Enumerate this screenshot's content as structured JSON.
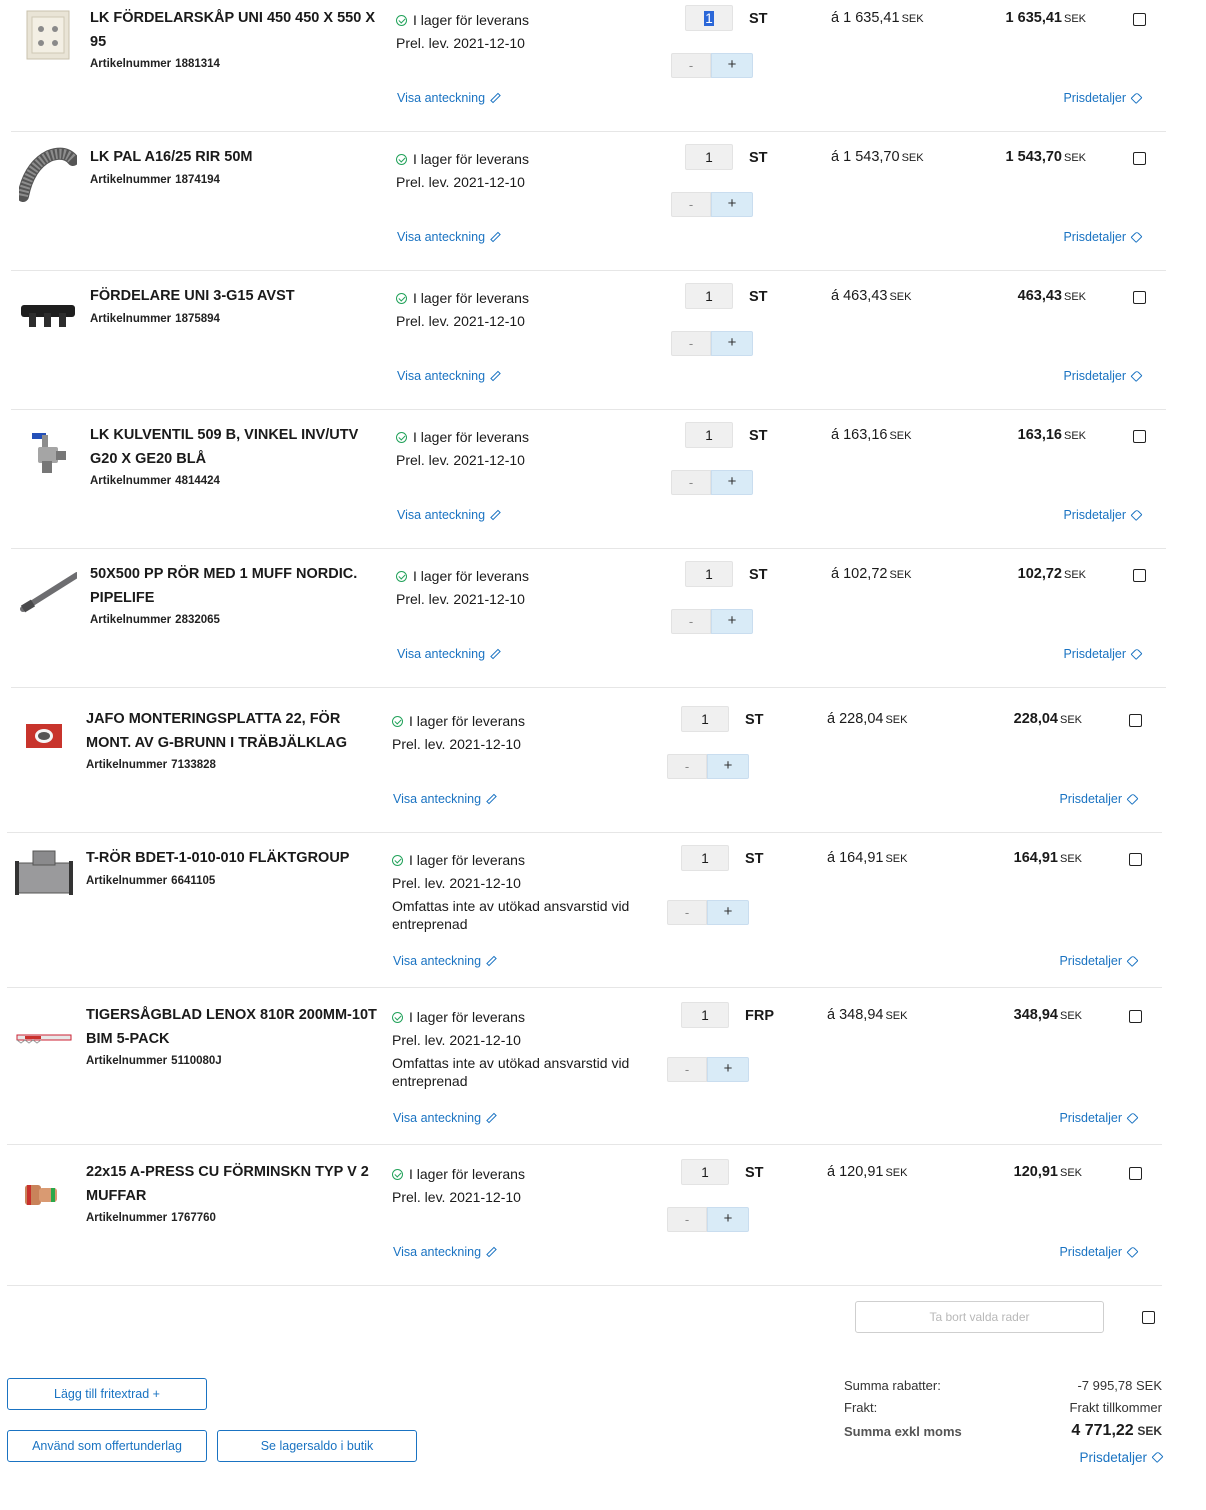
{
  "common": {
    "stock_label": "I lager för leverans",
    "visa_label": "Visa anteckning",
    "pris_label": "Prisdetaljer",
    "minus": "-",
    "plus": "+",
    "artnr_label": "Artikelnummer",
    "price_prefix": "á",
    "currency": "SEK"
  },
  "rows": [
    {
      "name": "LK FÖRDELARSKÅP UNI 450 450 X 550 X 95",
      "artnr": "1881314",
      "delivery": "Prel. lev. 2021-12-10",
      "note": "",
      "qty": "1",
      "unit": "ST",
      "unit_price": "1 635,41",
      "total": "1 635,41",
      "icon": "cabinet-icon"
    },
    {
      "name": "LK PAL A16/25 RIR 50M",
      "artnr": "1874194",
      "delivery": "Prel. lev. 2021-12-10",
      "note": "",
      "qty": "1",
      "unit": "ST",
      "unit_price": "1 543,70",
      "total": "1 543,70",
      "icon": "pipe-coil-icon"
    },
    {
      "name": "FÖRDELARE UNI 3-G15 AVST",
      "artnr": "1875894",
      "delivery": "Prel. lev. 2021-12-10",
      "note": "",
      "qty": "1",
      "unit": "ST",
      "unit_price": "463,43",
      "total": "463,43",
      "icon": "manifold-icon"
    },
    {
      "name": "LK KULVENTIL 509 B, VINKEL INV/UTV G20 X GE20 BLÅ",
      "artnr": "4814424",
      "delivery": "Prel. lev. 2021-12-10",
      "note": "",
      "qty": "1",
      "unit": "ST",
      "unit_price": "163,16",
      "total": "163,16",
      "icon": "valve-icon"
    },
    {
      "name": "50X500 PP RÖR MED 1 MUFF NORDIC. PIPELIFE",
      "artnr": "2832065",
      "delivery": "Prel. lev. 2021-12-10",
      "note": "",
      "qty": "1",
      "unit": "ST",
      "unit_price": "102,72",
      "total": "102,72",
      "icon": "pipe-icon"
    },
    {
      "name": "JAFO MONTERINGSPLATTA 22, FÖR MONT. AV G-BRUNN I TRÄBJÄLKLAG",
      "artnr": "7133828",
      "delivery": "Prel. lev. 2021-12-10",
      "note": "",
      "qty": "1",
      "unit": "ST",
      "unit_price": "228,04",
      "total": "228,04",
      "icon": "mounting-plate-icon"
    },
    {
      "name": "T-RÖR BDET-1-010-010 FLÄKTGROUP",
      "artnr": "6641105",
      "delivery": "Prel. lev. 2021-12-10",
      "note": "Omfattas inte av utökad ansvarstid vid entreprenad",
      "qty": "1",
      "unit": "ST",
      "unit_price": "164,91",
      "total": "164,91",
      "icon": "t-pipe-icon"
    },
    {
      "name": "TIGERSÅGBLAD LENOX 810R 200MM-10T BIM 5-PACK",
      "artnr": "5110080J",
      "delivery": "Prel. lev. 2021-12-10",
      "note": "Omfattas inte av utökad ansvarstid vid entreprenad",
      "qty": "1",
      "unit": "FRP",
      "unit_price": "348,94",
      "total": "348,94",
      "icon": "saw-blade-icon"
    },
    {
      "name": "22x15 A-PRESS CU FÖRMINSKN TYP V 2 MUFFAR",
      "artnr": "1767760",
      "delivery": "Prel. lev. 2021-12-10",
      "note": "",
      "qty": "1",
      "unit": "ST",
      "unit_price": "120,91",
      "total": "120,91",
      "icon": "reducer-fitting-icon"
    }
  ],
  "actions": {
    "remove_selected": "Ta bort valda rader",
    "add_freetext": "Lägg till fritextrad",
    "use_as_quote": "Använd som offertunderlag",
    "see_stock": "Se lagersaldo i butik"
  },
  "summary": {
    "discounts_label": "Summa rabatter:",
    "discounts_value": "-7 995,78 SEK",
    "freight_label": "Frakt:",
    "freight_value": "Frakt tillkommer",
    "total_label": "Summa exkl moms",
    "total_value": "4 771,22",
    "total_currency": "SEK",
    "pris_label": "Prisdetaljer"
  }
}
